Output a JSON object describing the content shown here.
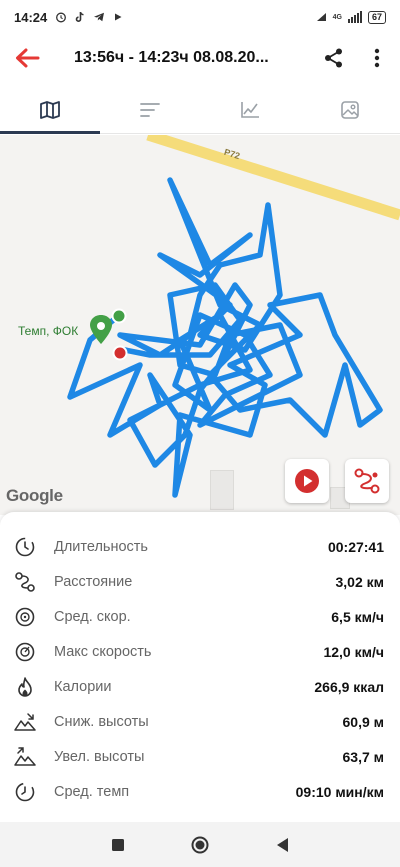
{
  "status_bar": {
    "time": "14:24",
    "network_label": "4G",
    "battery_level": "67",
    "left_icons": [
      "alarm-icon",
      "tiktok-icon",
      "telegram-icon",
      "youtube-icon"
    ],
    "right_icons": [
      "wifi-icon",
      "signal-icon",
      "battery-icon"
    ]
  },
  "app_bar": {
    "title": "13:56ч - 14:23ч   08.08.20...",
    "back_icon": "back-arrow-icon",
    "share_icon": "share-icon",
    "more_icon": "more-vert-icon",
    "accent": "#e53935"
  },
  "tabs": [
    {
      "name": "map-tab",
      "icon": "map-icon",
      "active": true
    },
    {
      "name": "laps-tab",
      "icon": "list-icon",
      "active": false
    },
    {
      "name": "chart-tab",
      "icon": "chart-icon",
      "active": false
    },
    {
      "name": "photos-tab",
      "icon": "photo-icon",
      "active": false
    }
  ],
  "map": {
    "road_label": "P72",
    "place_label": "Темп, ФОК",
    "attribution": "Google",
    "track_color": "#1e88e5",
    "play_button_color": "#d32f2f",
    "route_button_color": "#d32f2f"
  },
  "stats": [
    {
      "icon": "timer-icon",
      "label": "Длительность",
      "value": "00:27:41"
    },
    {
      "icon": "route-icon",
      "label": "Расстояние",
      "value": "3,02 км"
    },
    {
      "icon": "speed-icon",
      "label": "Сред. скор.",
      "value": "6,5 км/ч"
    },
    {
      "icon": "max-speed-icon",
      "label": "Макс скорость",
      "value": "12,0 км/ч"
    },
    {
      "icon": "calories-icon",
      "label": "Калории",
      "value": "266,9 ккал"
    },
    {
      "icon": "descent-icon",
      "label": "Сниж. высоты",
      "value": "60,9 м"
    },
    {
      "icon": "ascent-icon",
      "label": "Увел. высоты",
      "value": "63,7 м"
    },
    {
      "icon": "pace-icon",
      "label": "Сред. темп",
      "value": "09:10 мин/км"
    }
  ],
  "nav_bar": {
    "icons": [
      "recents-icon",
      "home-icon",
      "back-icon"
    ]
  }
}
